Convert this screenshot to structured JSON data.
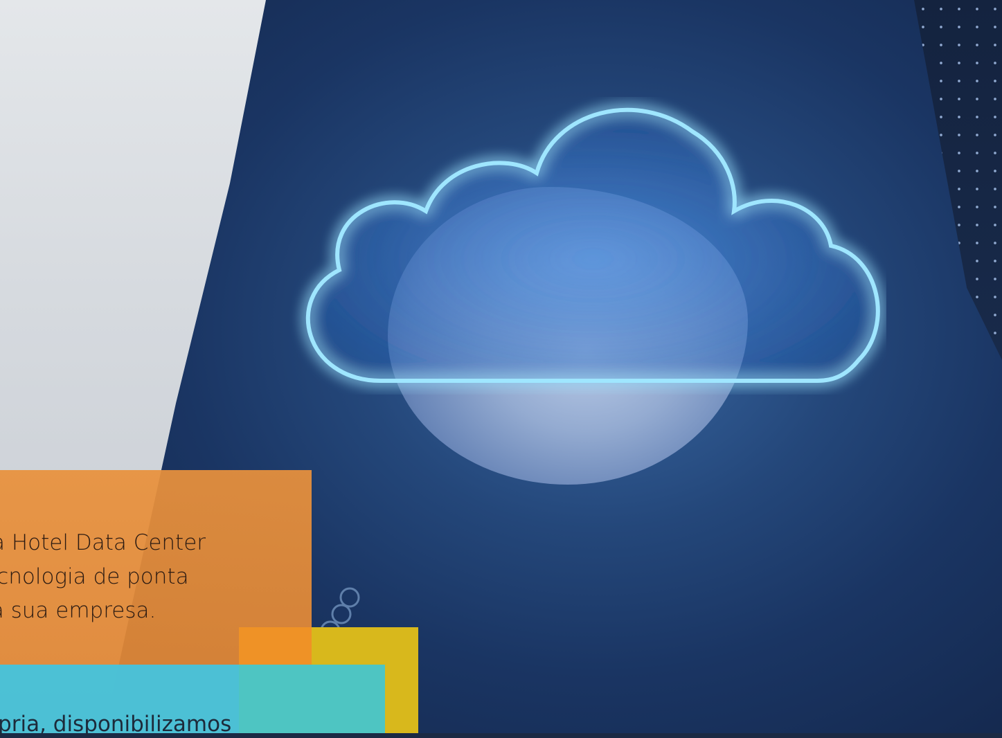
{
  "hero": {
    "image_icon": "cloud-computing-icon"
  },
  "intro_text": {
    "line1": "a Hotel Data Center",
    "line2": " tecnologia de ponta",
    "line3": "ra sua empresa."
  },
  "bottom_text": {
    "line": "rópria, disponibilizamos"
  },
  "colors": {
    "orange_panel": "#e9913c",
    "cyan_panel": "#46c3dc",
    "yellow_block": "#d8b81c",
    "cloud_glow": "#6fd2ff"
  }
}
